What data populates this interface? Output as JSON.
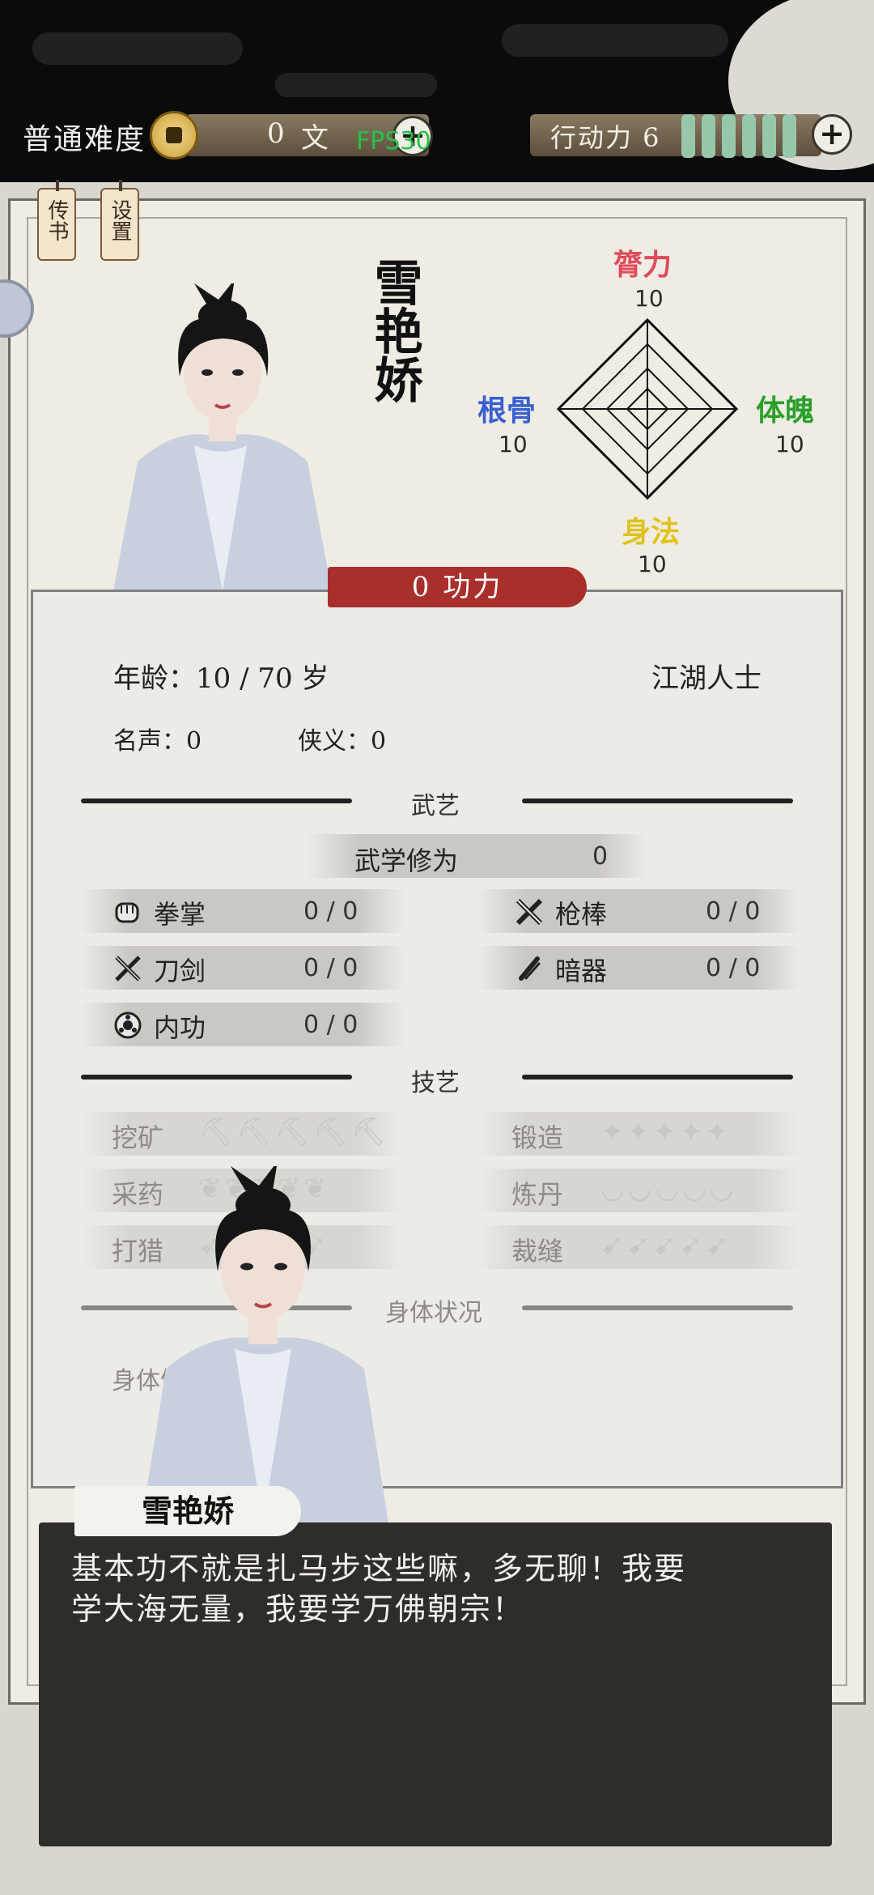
{
  "topbar": {
    "difficulty": "普通难度",
    "money_value": "0",
    "money_unit": "文",
    "fps": "FPS30",
    "action_label": "行动力 6",
    "action_points": 6,
    "plus_icon": "plus-icon"
  },
  "side_buttons": [
    "传书",
    "设置"
  ],
  "character": {
    "name": "雪艳娇",
    "stats": {
      "top": {
        "label": "膂力",
        "value": "10",
        "color": "#e04a5a"
      },
      "left": {
        "label": "根骨",
        "value": "10",
        "color": "#3a5fd0"
      },
      "right": {
        "label": "体魄",
        "value": "10",
        "color": "#2aa02a"
      },
      "bottom": {
        "label": "身法",
        "value": "10",
        "color": "#e0c21a"
      }
    },
    "power": "0 功力",
    "age": "年龄：10 / 70 岁",
    "identity": "江湖人士",
    "fame": "名声：0",
    "chivalry": "侠义：0"
  },
  "martial": {
    "title": "武艺",
    "cultivation_label": "武学修为",
    "cultivation_value": "0",
    "skills": [
      {
        "name": "拳掌",
        "value": "0 / 0",
        "icon": "fist-icon"
      },
      {
        "name": "枪棒",
        "value": "0 / 0",
        "icon": "spear-icon"
      },
      {
        "name": "刀剑",
        "value": "0 / 0",
        "icon": "swords-icon"
      },
      {
        "name": "暗器",
        "value": "0 / 0",
        "icon": "dart-icon"
      },
      {
        "name": "内功",
        "value": "0 / 0",
        "icon": "inner-power-icon"
      }
    ]
  },
  "crafts": {
    "title": "技艺",
    "items": [
      {
        "name": "挖矿",
        "icon": "pickaxe-icon"
      },
      {
        "name": "锻造",
        "icon": "anvil-icon"
      },
      {
        "name": "采药",
        "icon": "herb-icon"
      },
      {
        "name": "炼丹",
        "icon": "cauldron-icon"
      },
      {
        "name": "打猎",
        "icon": "knife-icon"
      },
      {
        "name": "裁缝",
        "icon": "needle-icon"
      }
    ]
  },
  "body": {
    "title": "身体状况",
    "health_label": "身体健康"
  },
  "dialog": {
    "speaker": "雪艳娇",
    "line1": "基本功不就是扎马步这些嘛，多无聊！我要",
    "line2": "学大海无量，我要学万佛朝宗！"
  }
}
